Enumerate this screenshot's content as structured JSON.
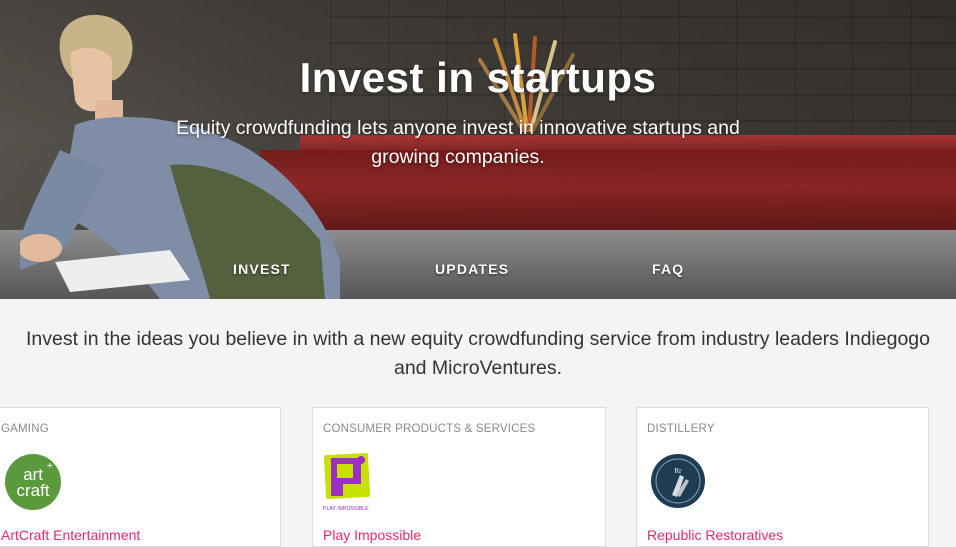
{
  "hero": {
    "title": "Invest in startups",
    "subtitle": "Equity crowdfunding lets anyone invest in innovative startups and growing companies.",
    "nav": [
      {
        "label": "INVEST"
      },
      {
        "label": "UPDATES"
      },
      {
        "label": "FAQ"
      }
    ]
  },
  "intro": {
    "text": "Invest in the ideas you believe in with a new equity crowdfunding service from industry leaders Indiegogo and MicroVentures."
  },
  "cards": [
    {
      "category": "GAMING",
      "logo_text_top": "art",
      "logo_text_bottom": "craft",
      "name": "ArtCraft Entertainment",
      "logo_color": "#5b9a3c"
    },
    {
      "category": "CONSUMER PRODUCTS & SERVICES",
      "logo_caption": "PLAY IMPOSSIBLE",
      "name": "Play Impossible",
      "logo_color": "#9b2ec4"
    },
    {
      "category": "DISTILLERY",
      "logo_text": "Rr",
      "name": "Republic Restoratives",
      "logo_color": "#1f3d52"
    }
  ],
  "colors": {
    "link": "#e8296b",
    "muted": "#8a8a8a",
    "body_text": "#333333"
  }
}
